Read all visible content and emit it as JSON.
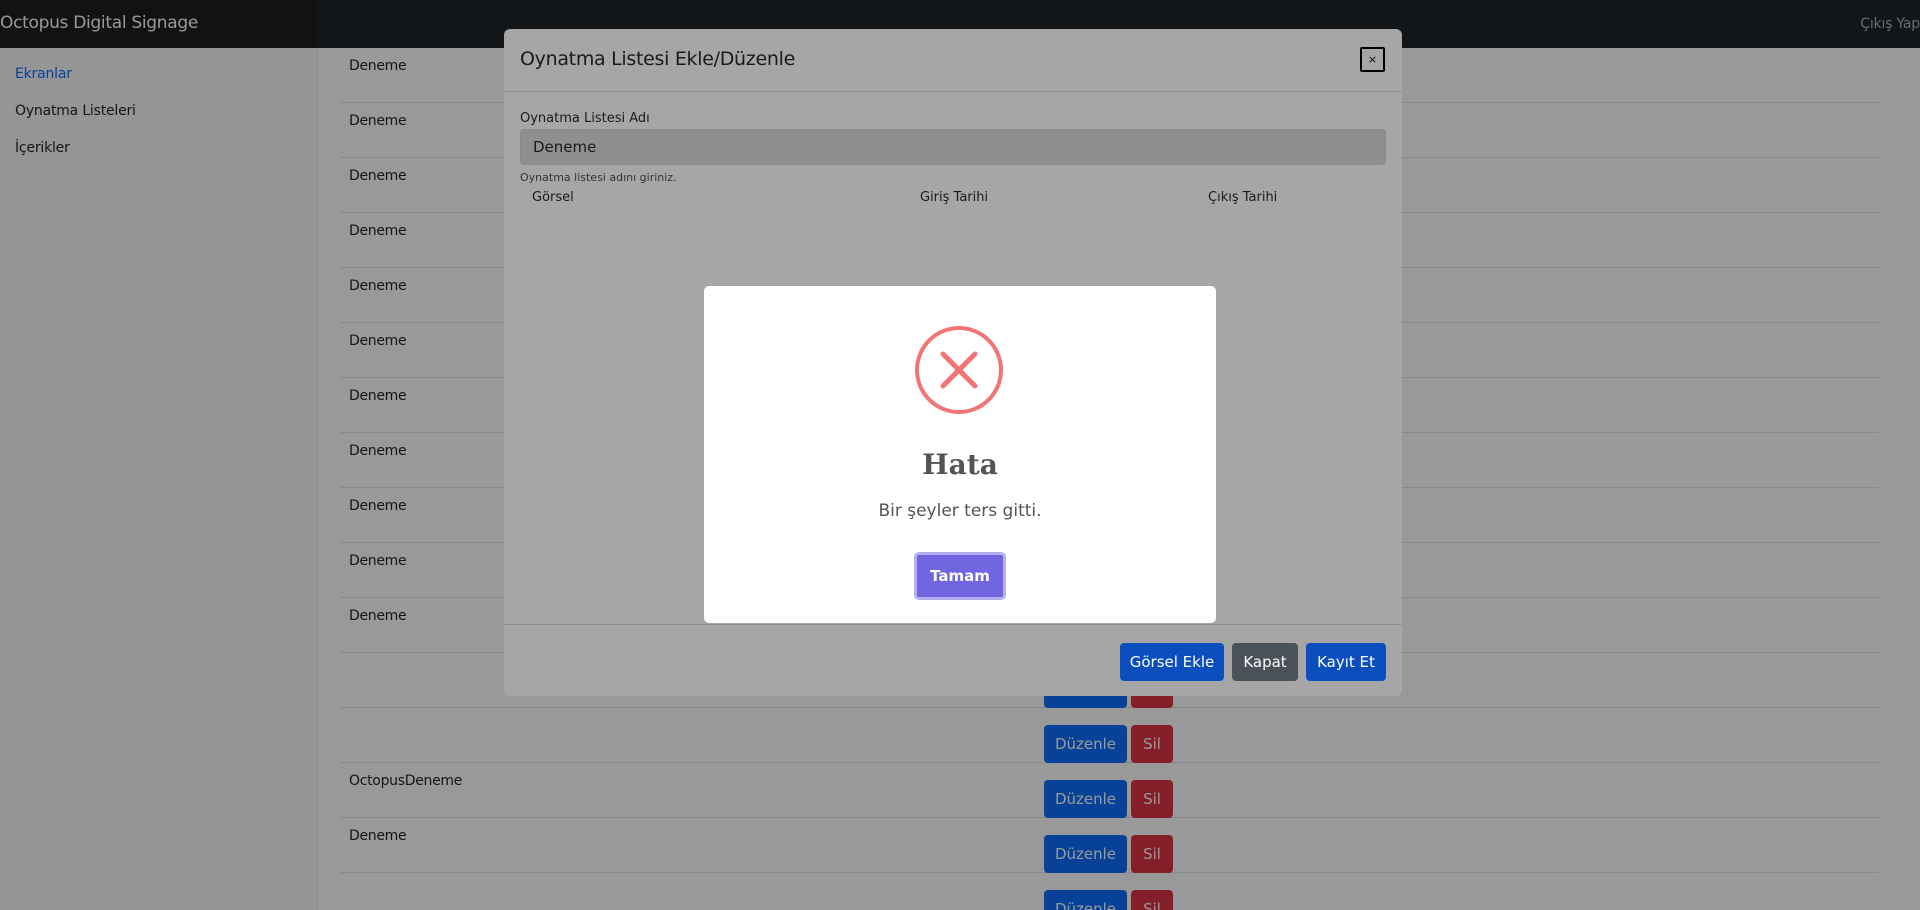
{
  "navbar": {
    "brand": "Octopus Digital Signage",
    "logout": "Çıkış Yap"
  },
  "sidebar": {
    "items": [
      {
        "label": "Ekranlar",
        "active": true
      },
      {
        "label": "Oynatma Listeleri",
        "active": false
      },
      {
        "label": "İçerikler",
        "active": false
      }
    ]
  },
  "table": {
    "rows": [
      {
        "name": "Deneme"
      },
      {
        "name": "Deneme"
      },
      {
        "name": "Deneme"
      },
      {
        "name": "Deneme"
      },
      {
        "name": "Deneme"
      },
      {
        "name": "Deneme"
      },
      {
        "name": "Deneme"
      },
      {
        "name": "Deneme"
      },
      {
        "name": "Deneme"
      },
      {
        "name": "Deneme"
      },
      {
        "name": "Deneme"
      },
      {
        "name": ""
      },
      {
        "name": ""
      },
      {
        "name": "OctopusDeneme"
      },
      {
        "name": "Deneme"
      },
      {
        "name": ""
      }
    ],
    "edit_label": "Düzenle",
    "delete_label": "Sil"
  },
  "modal": {
    "title": "Oynatma Listesi Ekle/Düzenle",
    "close_label": "×",
    "name_label": "Oynatma Listesi Adı",
    "name_value": "Deneme",
    "name_help": "Oynatma listesi adını giriniz.",
    "columns": [
      "Görsel",
      "Giriş Tarihi",
      "Çıkış Tarihi"
    ],
    "buttons": {
      "add_image": "Görsel Ekle",
      "close": "Kapat",
      "save": "Kayıt Et"
    }
  },
  "alert": {
    "icon": "error-x-icon",
    "title": "Hata",
    "text": "Bir şeyler ters gitti.",
    "confirm": "Tamam"
  },
  "colors": {
    "primary": "#0d6efd",
    "danger": "#dc3545",
    "navbar": "#212529",
    "alert_confirm": "#7066e0",
    "alert_error": "#f27474"
  }
}
